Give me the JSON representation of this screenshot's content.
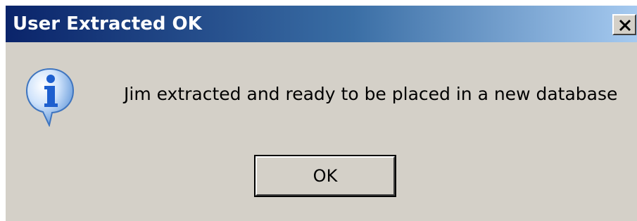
{
  "window": {
    "title": "User Extracted OK",
    "close_icon": "close-icon"
  },
  "message": {
    "icon": "information-icon",
    "text": "Jim extracted and ready to be placed in a new database"
  },
  "buttons": {
    "ok_label": "OK"
  },
  "colors": {
    "titlebar_start": "#0a246a",
    "titlebar_end": "#a6caf0",
    "dialog_bg": "#d4d0c8",
    "icon_blue": "#2a6fd6"
  }
}
